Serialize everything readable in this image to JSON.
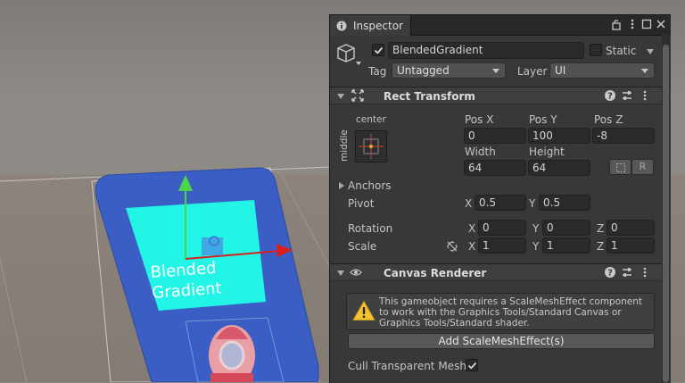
{
  "scene": {
    "label_line1": "Blended",
    "label_line2": "Gradient"
  },
  "inspector": {
    "tab_title": "Inspector",
    "header": {
      "object_name": "BlendedGradient",
      "active": true,
      "static_label": "Static",
      "static_checked": false,
      "tag_label": "Tag",
      "tag_value": "Untagged",
      "layer_label": "Layer",
      "layer_value": "UI"
    },
    "rect_transform": {
      "title": "Rect Transform",
      "anchor_h": "center",
      "anchor_v": "middle",
      "pos_x_label": "Pos X",
      "pos_y_label": "Pos Y",
      "pos_z_label": "Pos Z",
      "pos_x": "0",
      "pos_y": "100",
      "pos_z": "-8",
      "width_label": "Width",
      "height_label": "Height",
      "width": "64",
      "height": "64",
      "r_button": "R",
      "anchors_label": "Anchors",
      "pivot_label": "Pivot",
      "pivot_x": "0.5",
      "pivot_y": "0.5",
      "rotation_label": "Rotation",
      "rotation_x": "0",
      "rotation_y": "0",
      "rotation_z": "0",
      "scale_label": "Scale",
      "scale_x": "1",
      "scale_y": "1",
      "scale_z": "1",
      "x": "X",
      "y": "Y",
      "z": "Z"
    },
    "canvas_renderer": {
      "title": "Canvas Renderer",
      "warning": "This gameobject requires a ScaleMeshEffect component to work with the Graphics Tools/Standard Canvas or Graphics Tools/Standard shader.",
      "add_button": "Add ScaleMeshEffect(s)",
      "cull_label": "Cull Transparent Mesh",
      "cull_checked": true
    }
  },
  "colors": {
    "panel_bg": "#383838",
    "field_bg": "#2a2a2a",
    "card_blue": "#3a5ec4",
    "cyan": "#22f5e6",
    "gizmo_green": "#4cd64a",
    "gizmo_red": "#d8201e"
  }
}
